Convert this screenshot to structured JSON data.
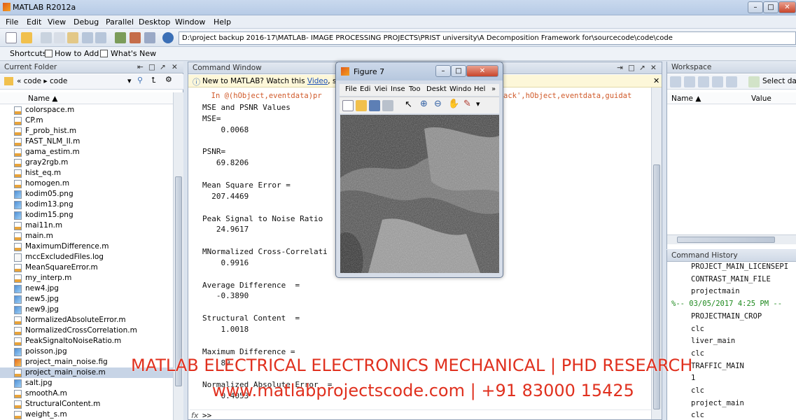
{
  "window": {
    "title": "MATLAB  R2012a",
    "controls": [
      "–",
      "□",
      "✕"
    ]
  },
  "menu": [
    "File",
    "Edit",
    "View",
    "Debug",
    "Parallel",
    "Desktop",
    "Window",
    "Help"
  ],
  "toolbar": {
    "current_folder_path": "D:\\project backup 2016-17\\MATLAB- IMAGE PROCESSING PROJECTS\\PRIST university\\A Decomposition Framework for\\sourcecode\\code\\code"
  },
  "shortcuts": {
    "label": "Shortcuts",
    "how_to_add": "How to Add",
    "whats_new": "What's New"
  },
  "current_folder": {
    "title": "Current Folder",
    "breadcrumb": "« code ▸ code",
    "column": "Name ▲",
    "files": [
      {
        "name": "colorspace.m",
        "type": "m"
      },
      {
        "name": "CP.m",
        "type": "m"
      },
      {
        "name": "F_prob_hist.m",
        "type": "m"
      },
      {
        "name": "FAST_NLM_II.m",
        "type": "m"
      },
      {
        "name": "gama_estim.m",
        "type": "m"
      },
      {
        "name": "gray2rgb.m",
        "type": "m"
      },
      {
        "name": "hist_eq.m",
        "type": "m"
      },
      {
        "name": "homogen.m",
        "type": "m"
      },
      {
        "name": "kodim05.png",
        "type": "img"
      },
      {
        "name": "kodim13.png",
        "type": "img"
      },
      {
        "name": "kodim15.png",
        "type": "img"
      },
      {
        "name": "mai11n.m",
        "type": "m"
      },
      {
        "name": "main.m",
        "type": "m"
      },
      {
        "name": "MaximumDifference.m",
        "type": "m"
      },
      {
        "name": "mccExcludedFiles.log",
        "type": "log"
      },
      {
        "name": "MeanSquareError.m",
        "type": "m"
      },
      {
        "name": "my_interp.m",
        "type": "m"
      },
      {
        "name": "new4.jpg",
        "type": "img"
      },
      {
        "name": "new5.jpg",
        "type": "img"
      },
      {
        "name": "new9.jpg",
        "type": "img"
      },
      {
        "name": "NormalizedAbsoluteError.m",
        "type": "m"
      },
      {
        "name": "NormalizedCrossCorrelation.m",
        "type": "m"
      },
      {
        "name": "PeakSignaltoNoiseRatio.m",
        "type": "m"
      },
      {
        "name": "poisson.jpg",
        "type": "img"
      },
      {
        "name": "project_main_noise.fig",
        "type": "fig"
      },
      {
        "name": "project_main_noise.m",
        "type": "m",
        "selected": true
      },
      {
        "name": "salt.jpg",
        "type": "img"
      },
      {
        "name": "smoothA.m",
        "type": "m"
      },
      {
        "name": "StructuralContent.m",
        "type": "m"
      },
      {
        "name": "weight_s.m",
        "type": "m"
      }
    ]
  },
  "command_window": {
    "title": "Command Window",
    "info_prefix": "New to MATLAB? Watch this ",
    "info_link": "Video",
    "info_suffix": ", see D",
    "error_line": "  In @(hObject,eventdata)pr",
    "error_tail": "ack',hObject,eventdata,guidat",
    "prompt": ">>",
    "fx": "fx",
    "lines": [
      "MSE and PSNR Values",
      "MSE=",
      "    0.0068",
      "",
      "PSNR=",
      "   69.8206",
      "",
      "Mean Square Error =",
      "  207.4469",
      "",
      "Peak Signal to Noise Ratio",
      "   24.9617",
      "",
      "MNormalized Cross-Correlati",
      "    0.9916",
      "",
      "Average Difference  =",
      "   -0.3890",
      "",
      "Structural Content  =",
      "    1.0018",
      "",
      "Maximum Difference =",
      "    89",
      "",
      "Normalized Absolute Error  =",
      "    0.4053"
    ]
  },
  "figure": {
    "title": "Figure 7",
    "menu": [
      "File",
      "Edi",
      "Viei",
      "Inse",
      "Too",
      "Deskt",
      "Windo",
      "Hel",
      "»"
    ]
  },
  "workspace": {
    "title": "Workspace",
    "select_data": "Select data",
    "col_name": "Name ▲",
    "col_value": "Value"
  },
  "command_history": {
    "title": "Command History",
    "lines": [
      {
        "text": "PROJECT_MAIN_LICENSEPI",
        "kind": "cmd"
      },
      {
        "text": "CONTRAST_MAIN_FILE",
        "kind": "cmd"
      },
      {
        "text": "projectmain",
        "kind": "cmd"
      },
      {
        "text": "%-- 03/05/2017 4:25 PM --",
        "kind": "session"
      },
      {
        "text": "PROJECTMAIN_CROP",
        "kind": "cmd"
      },
      {
        "text": "clc",
        "kind": "cmd"
      },
      {
        "text": "liver_main",
        "kind": "cmd"
      },
      {
        "text": "clc",
        "kind": "cmd"
      },
      {
        "text": "TRAFFIC_MAIN",
        "kind": "cmd"
      },
      {
        "text": "1",
        "kind": "cmd"
      },
      {
        "text": "clc",
        "kind": "cmd"
      },
      {
        "text": "project_main",
        "kind": "cmd"
      },
      {
        "text": "clc",
        "kind": "cmd"
      }
    ]
  },
  "watermark": {
    "line1": "MATLAB ELECTRICAL ELECTRONICS MECHANICAL | PHD RESEARCH",
    "line2": "www.matlabprojectscode.com | +91 83000 15425"
  },
  "colors": {
    "accent": "#3b6fb6",
    "watermark": "#e0301e",
    "selected_row": "#c7d4e6"
  }
}
